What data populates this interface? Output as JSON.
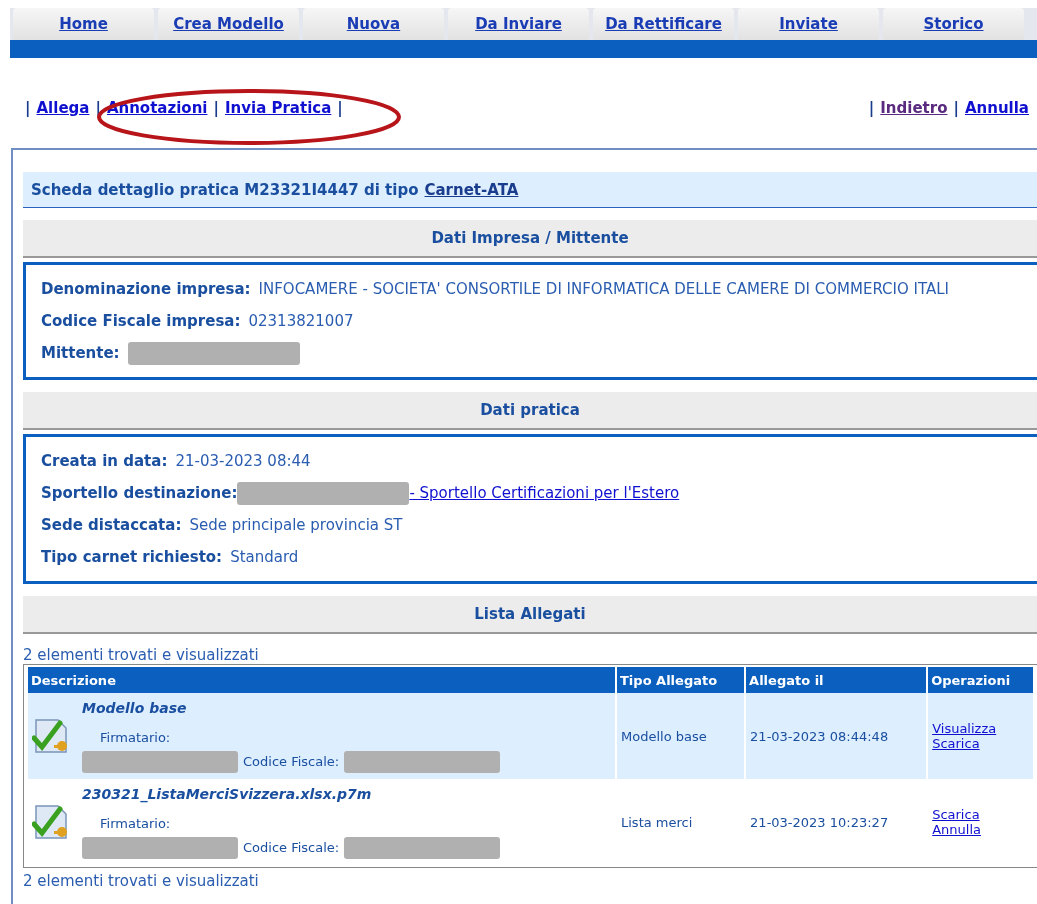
{
  "tabs": [
    {
      "label": "Home"
    },
    {
      "label": "Crea Modello"
    },
    {
      "label": "Nuova"
    },
    {
      "label": "Da Inviare"
    },
    {
      "label": "Da Rettificare"
    },
    {
      "label": "Inviate"
    },
    {
      "label": "Storico"
    }
  ],
  "actions_left": [
    {
      "kind": "separator",
      "label": "|"
    },
    {
      "kind": "link",
      "label": "Allega",
      "visited": false
    },
    {
      "kind": "separator",
      "label": "|"
    },
    {
      "kind": "link",
      "label": "Annotazioni",
      "visited": false
    },
    {
      "kind": "separator",
      "label": "|"
    },
    {
      "kind": "link",
      "label": "Invia Pratica",
      "visited": false
    },
    {
      "kind": "separator",
      "label": "|"
    }
  ],
  "actions_right": [
    {
      "kind": "separator",
      "label": "|"
    },
    {
      "kind": "link",
      "label": "Indietro",
      "visited": true
    },
    {
      "kind": "separator",
      "label": "|"
    },
    {
      "kind": "link",
      "label": "Annulla",
      "visited": false
    }
  ],
  "header": {
    "text": "Scheda dettaglio pratica M23321I4447 di tipo",
    "link": "Carnet-ATA"
  },
  "sections": [
    {
      "title": "Dati Impresa / Mittente",
      "fields": [
        {
          "kind": "text",
          "label": "Denominazione impresa:",
          "value": "INFOCAMERE - SOCIETA' CONSORTILE DI INFORMATICA DELLE CAMERE DI COMMERCIO ITALI"
        },
        {
          "kind": "text",
          "label": "Codice Fiscale impresa:",
          "value": "02313821007"
        },
        {
          "kind": "redacted",
          "label": "Mittente:"
        }
      ]
    },
    {
      "title": "Dati pratica",
      "fields": [
        {
          "kind": "text",
          "label": "Creata in data:",
          "value": "21-03-2023 08:44"
        },
        {
          "kind": "redacted_link",
          "label": "Sportello destinazione:",
          "link": "- Sportello Certificazioni per l'Estero"
        },
        {
          "kind": "text",
          "label": "Sede distaccata:",
          "value": "Sede principale provincia ST"
        },
        {
          "kind": "text",
          "label": "Tipo carnet richiesto:",
          "value": "Standard"
        }
      ]
    }
  ],
  "attachments": {
    "title": "Lista Allegati",
    "count_top": "2 elementi trovati e visualizzati",
    "columns": [
      "Descrizione",
      "Tipo Allegato",
      "Allegato il",
      "Operazioni"
    ],
    "rows": [
      {
        "name": "Modello base",
        "signer_label": "Firmatario:",
        "cf_label": "Codice Fiscale:",
        "type": "Modello base",
        "date": "21-03-2023 08:44:48",
        "operations": [
          "Visualizza",
          "Scarica"
        ],
        "selected": true
      },
      {
        "name": "230321_ListaMerciSvizzera.xlsx.p7m",
        "signer_label": "Firmatario:",
        "cf_label": "Codice Fiscale:",
        "type": "Lista merci",
        "date": "21-03-2023 10:23:27",
        "operations": [
          "Scarica",
          "Annulla"
        ],
        "selected": false
      }
    ],
    "count_bottom": "2 elementi trovati e visualizzati"
  }
}
